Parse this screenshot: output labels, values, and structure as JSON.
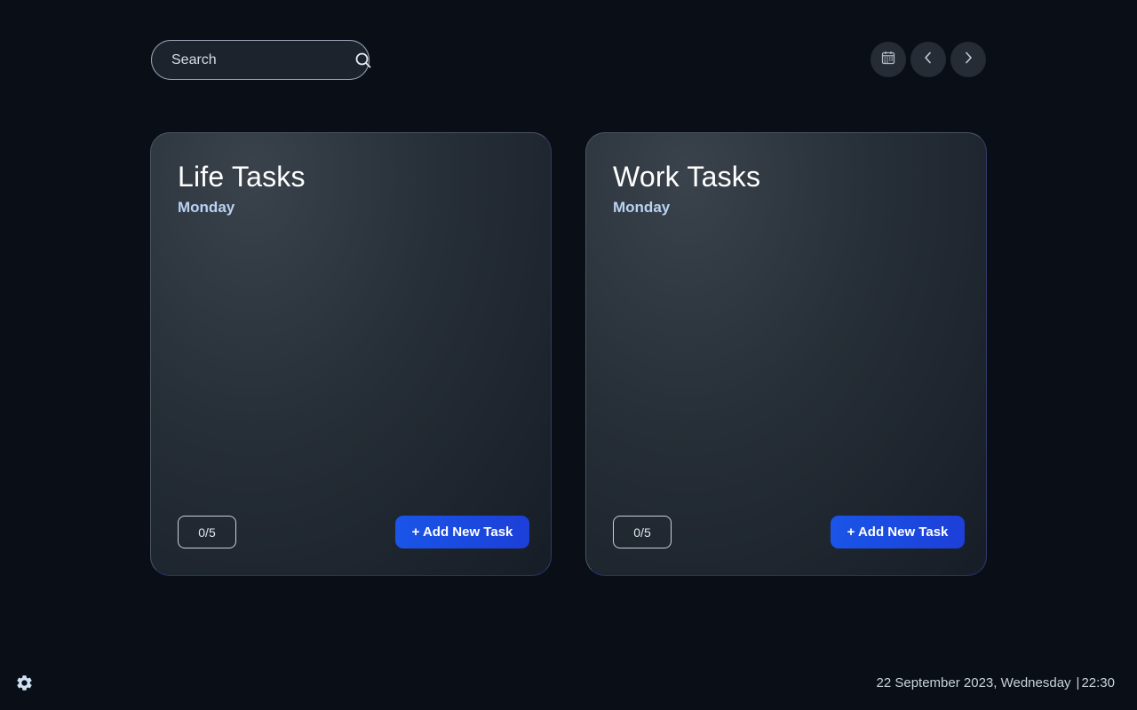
{
  "search": {
    "placeholder": "Search",
    "icon": "search-icon"
  },
  "nav": {
    "calendar_icon": "calendar-icon",
    "prev_icon": "chevron-left-icon",
    "next_icon": "chevron-right-icon"
  },
  "cards": [
    {
      "title": "Life Tasks",
      "day": "Monday",
      "counter": "0/5",
      "add_label": "+ Add New Task"
    },
    {
      "title": "Work Tasks",
      "day": "Monday",
      "counter": "0/5",
      "add_label": "+ Add New Task"
    }
  ],
  "footer": {
    "settings_icon": "gear-icon",
    "date": "22 September 2023, Wednesday",
    "separator": "|",
    "time": "22:30"
  },
  "colors": {
    "background": "#0a0f17",
    "accent": "#1a55e8",
    "day_label": "#b9d2f2"
  }
}
